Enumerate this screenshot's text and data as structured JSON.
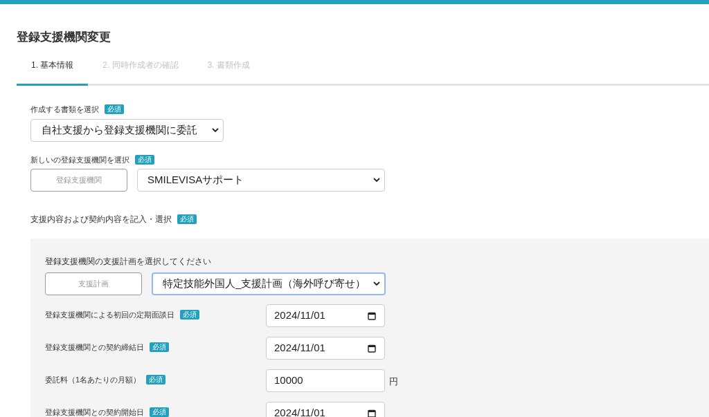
{
  "page": {
    "title": "登録支援機関変更"
  },
  "tabs": [
    {
      "label": "1. 基本情報",
      "selected": true
    },
    {
      "label": "2. 同時作成者の確認",
      "selected": false
    },
    {
      "label": "3. 書類作成",
      "selected": false
    }
  ],
  "document_type": {
    "label": "作成する書類を選択",
    "badge": "必須",
    "value": "自社支援から登録支援機関に委託"
  },
  "agency": {
    "label": "新しいの登録支援機関を選択",
    "badge": "必須",
    "button": "登録支援機関",
    "value": "SMILEVISAサポート"
  },
  "contract": {
    "label": "支援内容および契約内容を記入・選択",
    "badge": "必須",
    "plan": {
      "label": "登録支援機関の支援計画を選択してください",
      "button": "支援計画",
      "value": "特定技能外国人_支援計画（海外呼び寄せ）",
      "focused": true
    },
    "fields": [
      {
        "kind": "date",
        "label": "登録支援機関による初回の定期面談日",
        "badge": "必須",
        "value": "2024/11/01"
      },
      {
        "kind": "date",
        "label": "登録支援機関との契約締結日",
        "badge": "必須",
        "value": "2024/11/01"
      },
      {
        "kind": "number",
        "label": "委託料（1名あたりの月額）",
        "badge": "必須",
        "value": "10000",
        "unit": "円"
      },
      {
        "kind": "date",
        "label": "登録支援機関との契約開始日",
        "badge": "必須",
        "value": "2024/11/01"
      }
    ]
  }
}
